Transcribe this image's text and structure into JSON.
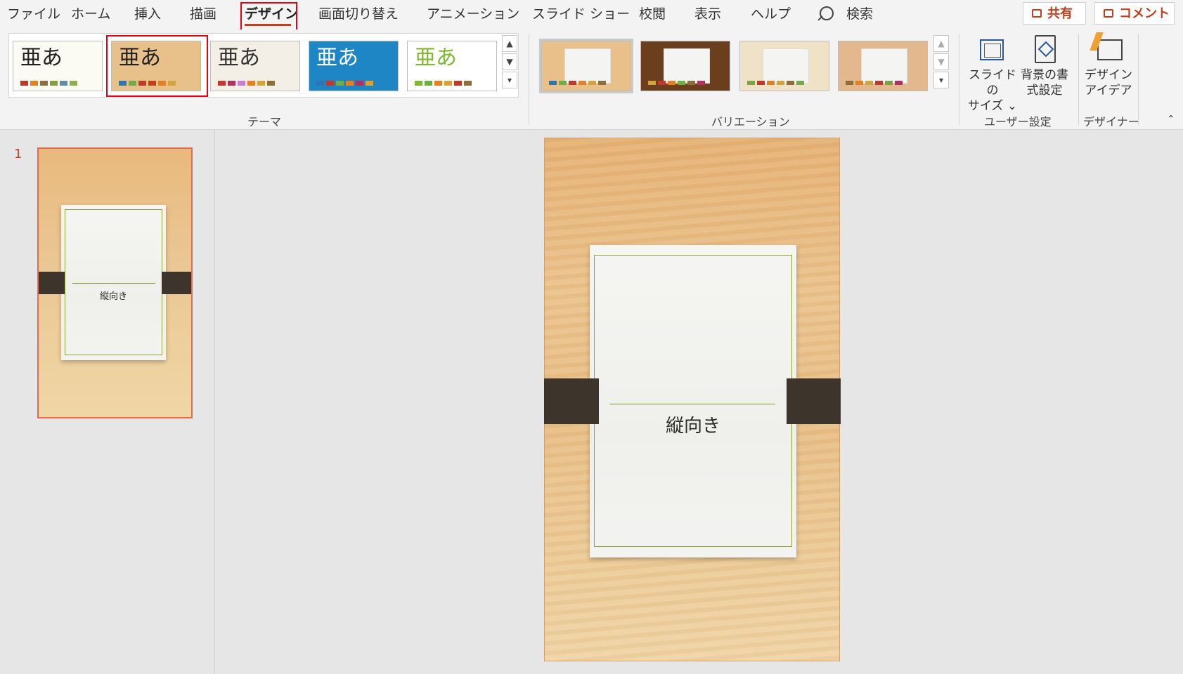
{
  "menu": {
    "tabs": [
      "ファイル",
      "ホーム",
      "挿入",
      "描画",
      "デザイン",
      "画面切り替え",
      "アニメーション",
      "スライド ショー",
      "校閲",
      "表示",
      "ヘルプ"
    ],
    "active_tab": "デザイン",
    "search_label": "検索",
    "share_label": "共有",
    "comment_label": "コメント"
  },
  "ribbon": {
    "themes_label": "テーマ",
    "variations_label": "バリエーション",
    "user_settings_label": "ユーザー設定",
    "designer_label": "デザイナー",
    "theme_glyph": "亜あ",
    "slide_size_label_1": "スライドの",
    "slide_size_label_2": "サイズ ⌄",
    "bg_format_label_1": "背景の書",
    "bg_format_label_2": "式設定",
    "design_ideas_label_1": "デザイン",
    "design_ideas_label_2": "アイデア",
    "themes": [
      {
        "name": "theme-1",
        "glyph_color": "#222222",
        "bg": "#fbfbf3",
        "swatches": [
          "#c0392b",
          "#e67e22",
          "#8c6f3c",
          "#7fa23a",
          "#5c8fa8",
          "#8cb04a"
        ]
      },
      {
        "name": "theme-2-selected",
        "glyph_color": "#222222",
        "bg": "#e8c08a",
        "swatches": [
          "#2e75b6",
          "#70ad47",
          "#c0392b",
          "#c43e1c",
          "#e67e22",
          "#d4a33a"
        ]
      },
      {
        "name": "theme-3",
        "glyph_color": "#333333",
        "bg": "#f3efe6",
        "swatches": [
          "#c0392b",
          "#b03060",
          "#c77dd6",
          "#e67e22",
          "#d4a33a",
          "#8c6f3c"
        ]
      },
      {
        "name": "theme-4",
        "glyph_color": "#ffffff",
        "bg": "#1f86c6",
        "swatches": [
          "#2e75b6",
          "#c0392b",
          "#70ad47",
          "#e67e22",
          "#b03060",
          "#d4a33a"
        ]
      },
      {
        "name": "theme-5",
        "glyph_color": "#7fb830",
        "bg": "#ffffff",
        "swatches": [
          "#7fb830",
          "#70ad47",
          "#e67e22",
          "#d4a33a",
          "#c0392b",
          "#8c6f3c"
        ]
      }
    ],
    "variations": [
      {
        "name": "variation-1",
        "bg": "#e9c08a",
        "swatches": [
          "#2e75b6",
          "#70ad47",
          "#c0392b",
          "#e67e22",
          "#d4a33a",
          "#8c6f3c"
        ]
      },
      {
        "name": "variation-2",
        "bg": "#6b3e1e",
        "swatches": [
          "#d4a33a",
          "#c0392b",
          "#e67e22",
          "#70ad47",
          "#8c6f3c",
          "#b03060"
        ]
      },
      {
        "name": "variation-3",
        "bg": "#efe2c6",
        "swatches": [
          "#7fa23a",
          "#c0392b",
          "#e67e22",
          "#d4a33a",
          "#8c6f3c",
          "#70ad47"
        ]
      },
      {
        "name": "variation-4",
        "bg": "#e4b88f",
        "swatches": [
          "#8c6f3c",
          "#e67e22",
          "#d4a33a",
          "#c0392b",
          "#7fa23a",
          "#b03060"
        ]
      }
    ]
  },
  "slides_panel": {
    "slide_number": "1",
    "thumb_title": "縦向き"
  },
  "slide": {
    "title": "縦向き"
  }
}
